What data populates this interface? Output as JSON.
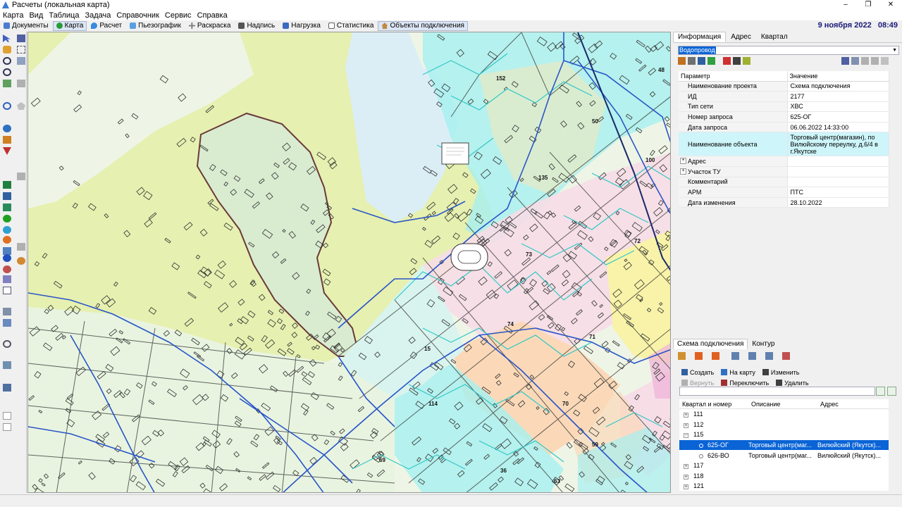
{
  "window": {
    "title": "Расчеты (локальная карта)",
    "controls": [
      "–",
      "❐",
      "✕"
    ]
  },
  "menu": [
    "Карта",
    "Вид",
    "Таблица",
    "Задача",
    "Справочник",
    "Сервис",
    "Справка"
  ],
  "tabs": [
    {
      "label": "Документы",
      "color": "#4a7bd0"
    },
    {
      "label": "Карта",
      "color": "#2a9a3a",
      "active": true
    },
    {
      "label": "Расчет",
      "color": "#3a8ae0"
    },
    {
      "label": "Пьезографик",
      "color": "#5aa0e0"
    },
    {
      "label": "Раскраска",
      "color": "#7a7a7a"
    },
    {
      "label": "Надпись",
      "color": "#555555"
    },
    {
      "label": "Нагрузка",
      "color": "#3a6ac0"
    },
    {
      "label": "Статистика",
      "color": "#606060"
    },
    {
      "label": "Объекты подключения",
      "color": "#c08a40"
    }
  ],
  "datetime": {
    "date": "9 ноября 2022",
    "time": "08:49"
  },
  "info_panel": {
    "tabs": [
      "Информация",
      "Адрес",
      "Квартал"
    ],
    "layer": "Водопровод",
    "table": {
      "headers": [
        "Параметр",
        "Значение"
      ],
      "rows": [
        {
          "param": "Наименование проекта",
          "value": "Схема подключения"
        },
        {
          "param": "ИД",
          "value": "2177"
        },
        {
          "param": "Тип сети",
          "value": "ХВС"
        },
        {
          "param": "Номер запроса",
          "value": "625-ОГ"
        },
        {
          "param": "Дата запроса",
          "value": "06.06.2022 14:33:00"
        },
        {
          "param": "Наименование объекта",
          "value": "Торговый центр(магазин), по Вилюйскому переулку, д.6/4 в г.Якутске"
        },
        {
          "param": "Адрес",
          "value": ""
        },
        {
          "param": "Участок ТУ",
          "value": ""
        },
        {
          "param": "Комментарий",
          "value": ""
        },
        {
          "param": "АРМ",
          "value": "ПТС"
        },
        {
          "param": "Дата изменения",
          "value": "28.10.2022"
        }
      ]
    }
  },
  "scheme_panel": {
    "tabs": [
      "Схема подключения",
      "Контур"
    ],
    "actions": {
      "create": "Создать",
      "to_map": "На карту",
      "edit": "Изменить",
      "revert": "Вернуть",
      "switch": "Переключить",
      "delete": "Удалить"
    },
    "tree_headers": [
      "Квартал и номер",
      "Описание",
      "Адрес"
    ],
    "tree": [
      {
        "label": "111",
        "type": "group",
        "expanded": false
      },
      {
        "label": "112",
        "type": "group",
        "expanded": false
      },
      {
        "label": "115",
        "type": "group",
        "expanded": true
      },
      {
        "label": "625-ОГ",
        "type": "child",
        "desc": "Торговый центр(маг...",
        "addr": "Вилюйский  (Якутск)...",
        "selected": true
      },
      {
        "label": "626-ВО",
        "type": "child",
        "desc": "Торговый центр(маг...",
        "addr": "Вилюйский  (Якутск)..."
      },
      {
        "label": "117",
        "type": "group",
        "expanded": false
      },
      {
        "label": "118",
        "type": "group",
        "expanded": false
      },
      {
        "label": "121",
        "type": "group",
        "expanded": false
      }
    ]
  },
  "map": {
    "labels": [
      "152",
      "48",
      "50",
      "100",
      "135",
      "73",
      "72",
      "74",
      "71",
      "15",
      "114",
      "70",
      "69",
      "36",
      "59",
      "63"
    ],
    "colors": {
      "lake": "#dbeef6",
      "park": "#e6f0b0",
      "zone_green": "#d9ecd0",
      "cyan": "#a6f0f0",
      "pink": "#f6dde6",
      "orange": "#fbd9b8",
      "yellow": "#f8f3a8",
      "pipe": "#2a55c8",
      "cyan_pipe": "#30c8c8"
    }
  }
}
